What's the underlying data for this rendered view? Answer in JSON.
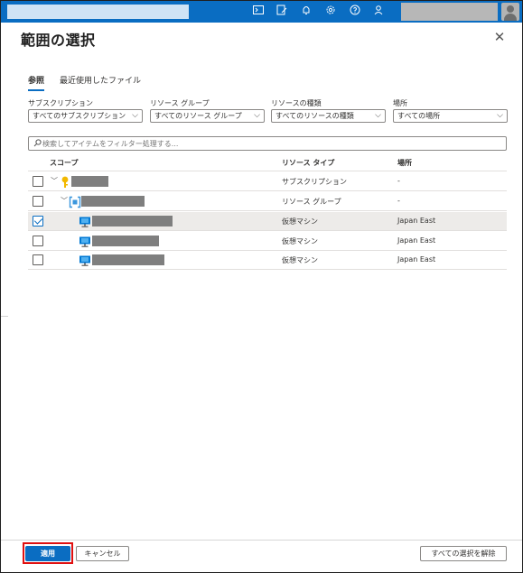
{
  "panel": {
    "title": "範囲の選択",
    "close_glyph": "✕"
  },
  "header": {
    "icons": [
      "terminal-icon",
      "feedback-icon",
      "bell-icon",
      "gear-icon",
      "help-icon",
      "person-feedback-icon"
    ],
    "accent": "#0a6dc2"
  },
  "tabs": [
    {
      "label": "参照",
      "active": true
    },
    {
      "label": "最近使用したファイル",
      "active": false
    }
  ],
  "filters": [
    {
      "label": "サブスクリプション",
      "value": "すべてのサブスクリプション"
    },
    {
      "label": "リソース グループ",
      "value": "すべてのリソース グループ"
    },
    {
      "label": "リソースの種類",
      "value": "すべてのリソースの種類"
    },
    {
      "label": "場所",
      "value": "すべての場所"
    }
  ],
  "search": {
    "placeholder": "検索してアイテムをフィルター処理する..."
  },
  "grid": {
    "columns": [
      "スコープ",
      "リソース タイプ",
      "場所"
    ],
    "rows": [
      {
        "type": "サブスクリプション",
        "location": "-",
        "checked": false,
        "icon": "key-icon"
      },
      {
        "type": "リソース グループ",
        "location": "-",
        "checked": false,
        "icon": "resource-group-icon"
      },
      {
        "type": "仮想マシン",
        "location": "Japan East",
        "checked": true,
        "icon": "virtual-machine-icon"
      },
      {
        "type": "仮想マシン",
        "location": "Japan East",
        "checked": false,
        "icon": "virtual-machine-icon"
      },
      {
        "type": "仮想マシン",
        "location": "Japan East",
        "checked": false,
        "icon": "virtual-machine-icon"
      }
    ]
  },
  "footer": {
    "apply_label": "適用",
    "cancel_label": "キャンセル",
    "clear_label": "すべての選択を解除"
  },
  "colors": {
    "primary": "#0a6dc2",
    "highlight": "#e01010",
    "selected_row": "#edebe9"
  }
}
